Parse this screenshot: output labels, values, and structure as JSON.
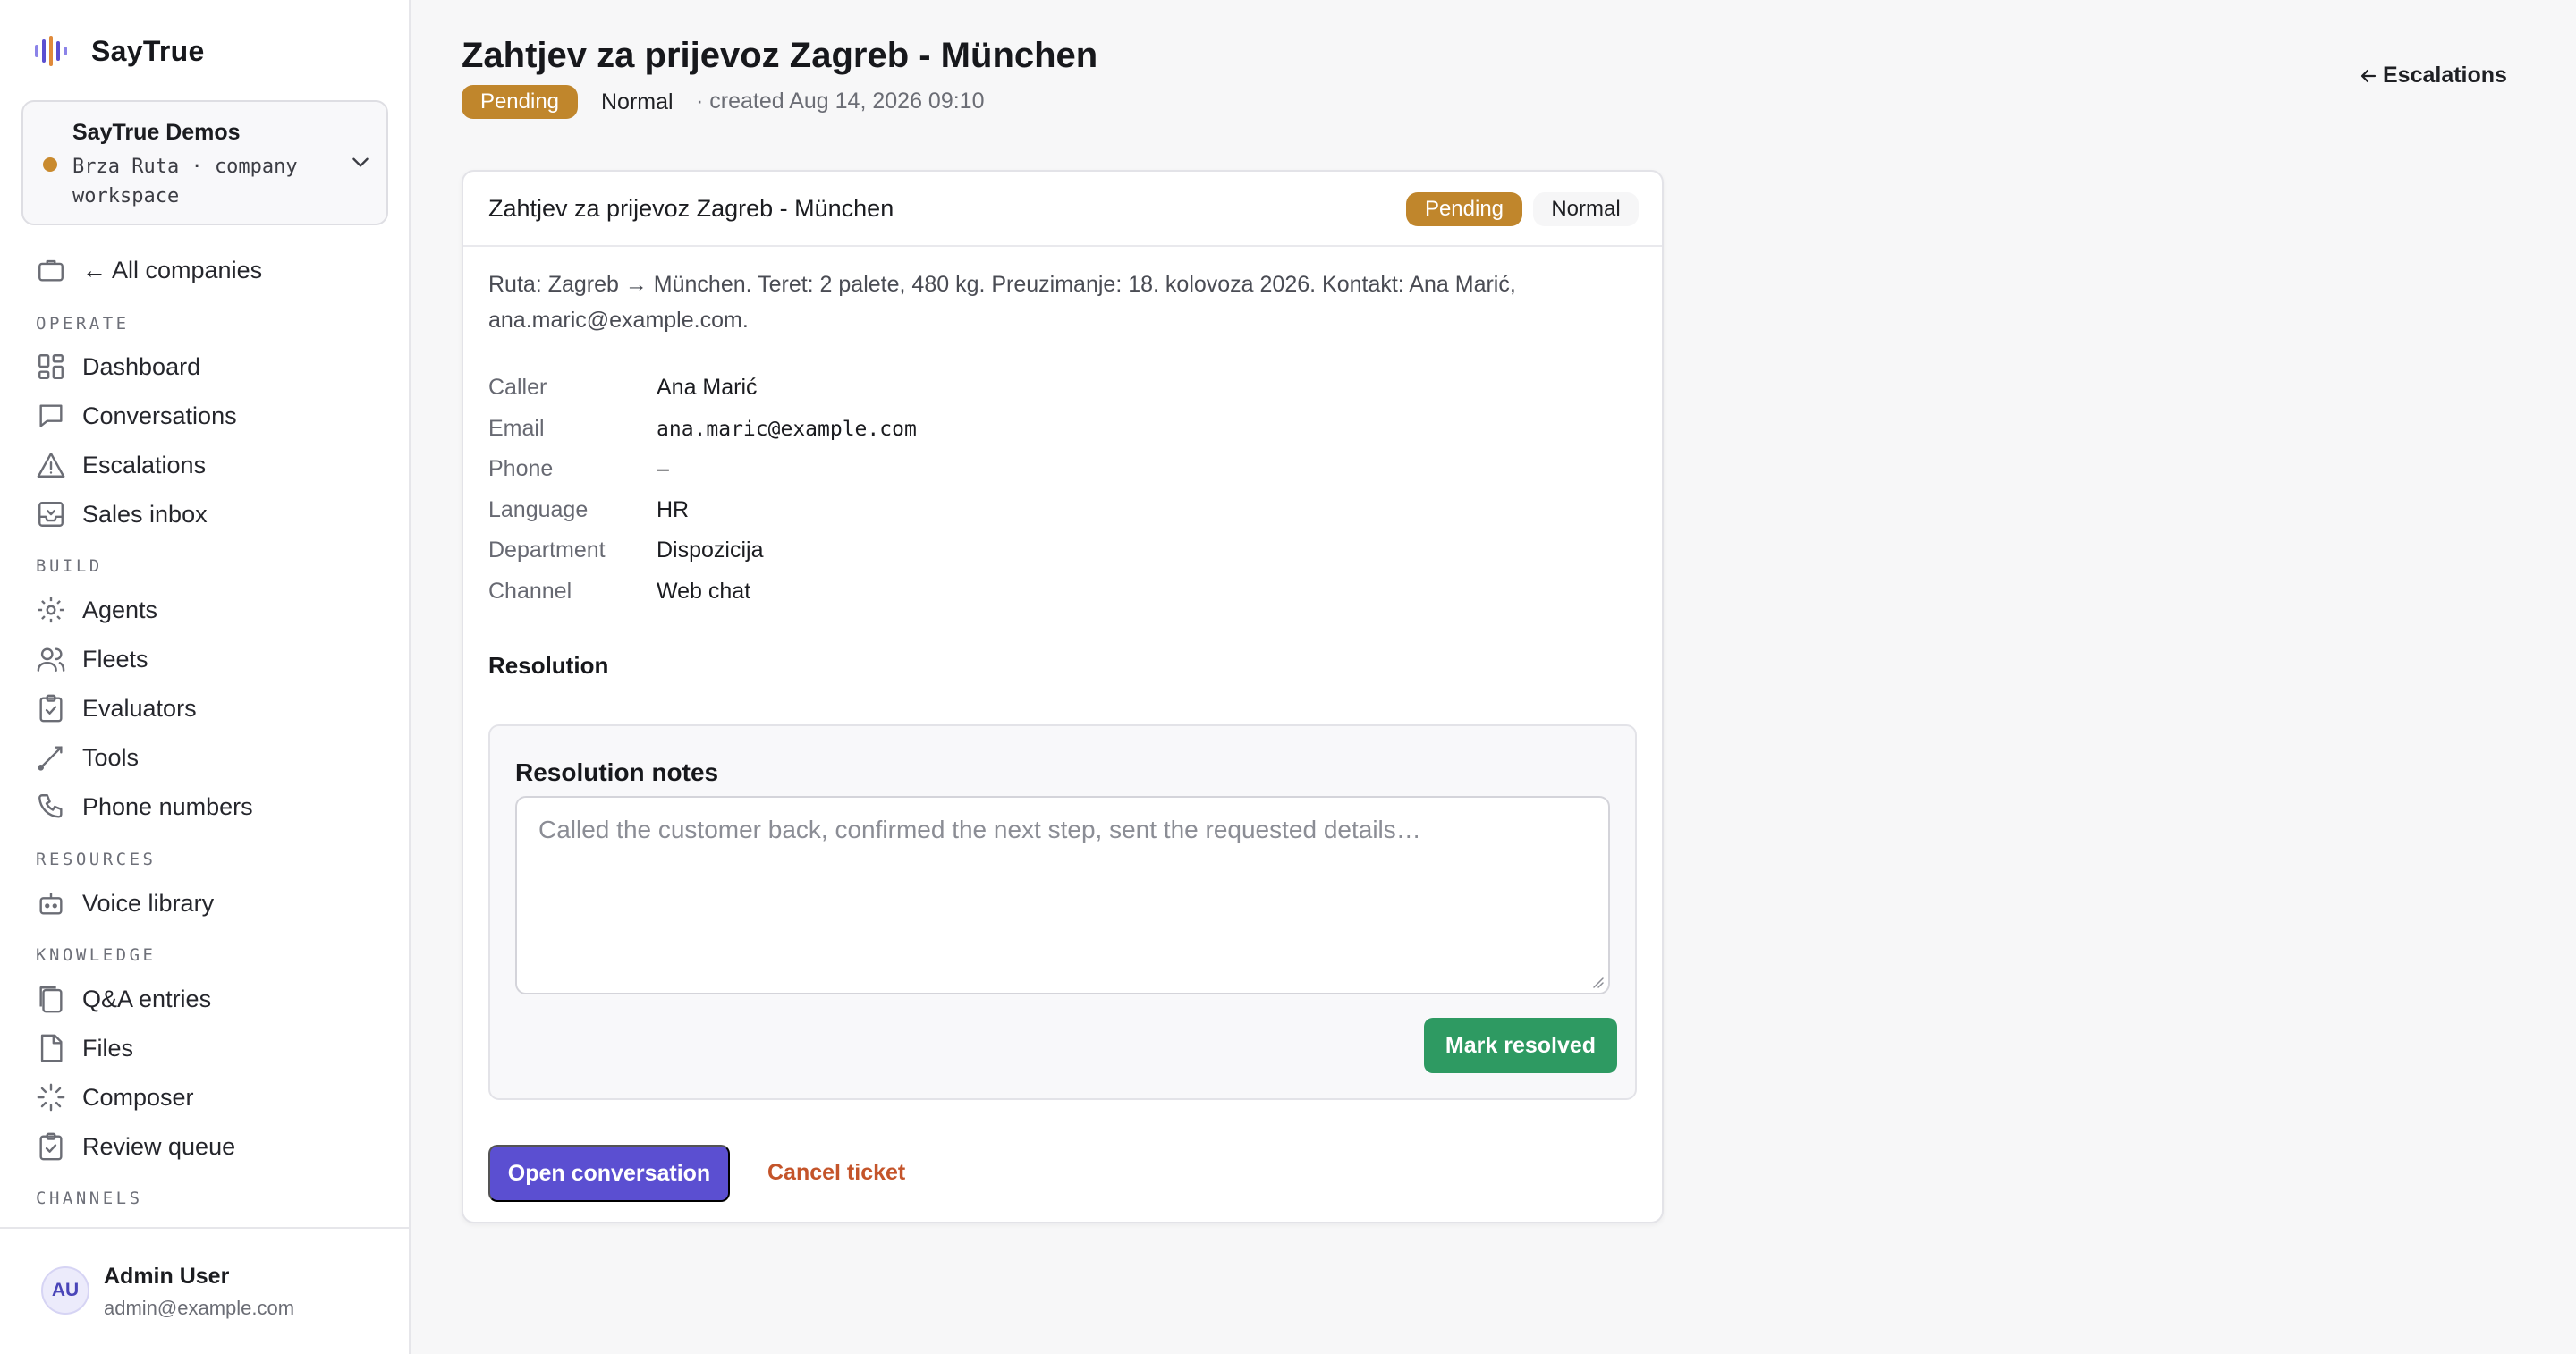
{
  "brand": {
    "name": "SayTrue"
  },
  "workspace": {
    "name": "SayTrue Demos",
    "subtitle": "Brza Ruta · company workspace"
  },
  "sidebar": {
    "all_companies": "← All companies",
    "sections": [
      {
        "label": "OPERATE",
        "items": [
          {
            "label": "Dashboard",
            "icon": "dashboard-icon"
          },
          {
            "label": "Conversations",
            "icon": "chat-bubble-icon"
          },
          {
            "label": "Escalations",
            "icon": "warning-triangle-icon"
          },
          {
            "label": "Sales inbox",
            "icon": "inbox-icon"
          }
        ]
      },
      {
        "label": "BUILD",
        "items": [
          {
            "label": "Agents",
            "icon": "gear-icon"
          },
          {
            "label": "Fleets",
            "icon": "users-icon"
          },
          {
            "label": "Evaluators",
            "icon": "clipboard-check-icon"
          },
          {
            "label": "Tools",
            "icon": "link-icon"
          },
          {
            "label": "Phone numbers",
            "icon": "phone-icon"
          }
        ]
      },
      {
        "label": "RESOURCES",
        "items": [
          {
            "label": "Voice library",
            "icon": "robot-icon"
          }
        ]
      },
      {
        "label": "KNOWLEDGE",
        "items": [
          {
            "label": "Q&A entries",
            "icon": "copy-icon"
          },
          {
            "label": "Files",
            "icon": "file-icon"
          },
          {
            "label": "Composer",
            "icon": "sparkle-loader-icon"
          },
          {
            "label": "Review queue",
            "icon": "clipboard-check-icon"
          }
        ]
      },
      {
        "label": "CHANNELS",
        "items": []
      }
    ]
  },
  "user": {
    "initials": "AU",
    "name": "Admin User",
    "email": "admin@example.com"
  },
  "header": {
    "title": "Zahtjev za prijevoz Zagreb - München",
    "status": "Pending",
    "priority": "Normal",
    "created": "· created Aug 14, 2026 09:10",
    "back_label": "Escalations"
  },
  "ticket": {
    "title": "Zahtjev za prijevoz Zagreb - München",
    "status": "Pending",
    "priority": "Normal",
    "description": "Ruta: Zagreb → München. Teret: 2 palete, 480 kg. Preuzimanje: 18. kolovoza 2026. Kontakt: Ana Marić, ana.maric@example.com.",
    "details": [
      {
        "label": "Caller",
        "value": "Ana Marić"
      },
      {
        "label": "Email",
        "value": "ana.maric@example.com"
      },
      {
        "label": "Phone",
        "value": "–"
      },
      {
        "label": "Language",
        "value": "HR"
      },
      {
        "label": "Department",
        "value": "Dispozicija"
      },
      {
        "label": "Channel",
        "value": "Web chat"
      }
    ],
    "resolution": {
      "heading": "Resolution",
      "notes_label": "Resolution notes",
      "placeholder": "Called the customer back, confirmed the next step, sent the requested details…",
      "resolve_label": "Mark resolved"
    },
    "open_conversation_label": "Open conversation",
    "cancel_label": "Cancel ticket"
  },
  "colors": {
    "accent": "#5b4fd1",
    "pending": "#c0862c",
    "resolve": "#2e9a62",
    "cancel": "#c4542a"
  }
}
